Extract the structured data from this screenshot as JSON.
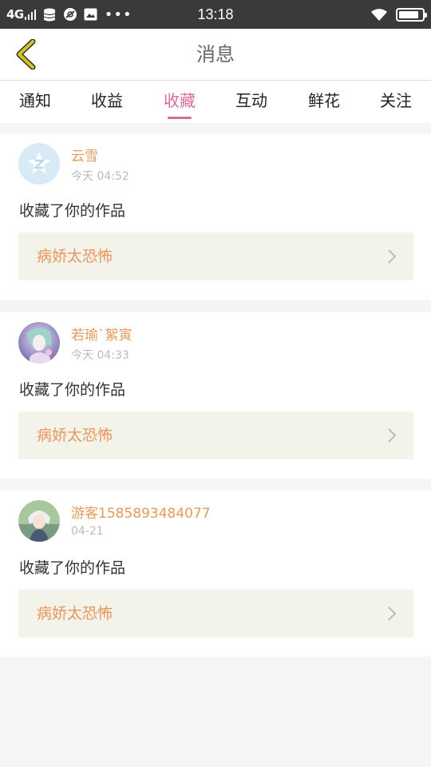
{
  "status_bar": {
    "network": "4G",
    "time": "13:18"
  },
  "header": {
    "title": "消息"
  },
  "tabs": [
    {
      "label": "通知",
      "active": false
    },
    {
      "label": "收益",
      "active": false
    },
    {
      "label": "收藏",
      "active": true
    },
    {
      "label": "互动",
      "active": false
    },
    {
      "label": "鲜花",
      "active": false
    },
    {
      "label": "关注",
      "active": false
    }
  ],
  "notifications": [
    {
      "username": "云雪",
      "time": "今天 04:52",
      "message": "收藏了你的作品",
      "work_title": "病娇太恐怖"
    },
    {
      "username": "若瑜`絮寅",
      "time": "今天 04:33",
      "message": "收藏了你的作品",
      "work_title": "病娇太恐怖"
    },
    {
      "username": "游客1585893484077",
      "time": "04-21",
      "message": "收藏了你的作品",
      "work_title": "病娇太恐怖"
    }
  ],
  "colors": {
    "accent": "#d76a9c",
    "username": "#e69a5c",
    "work_title": "#e6965a",
    "status_bar_bg": "#3a3a3a",
    "back_icon": "#d8c21f"
  }
}
